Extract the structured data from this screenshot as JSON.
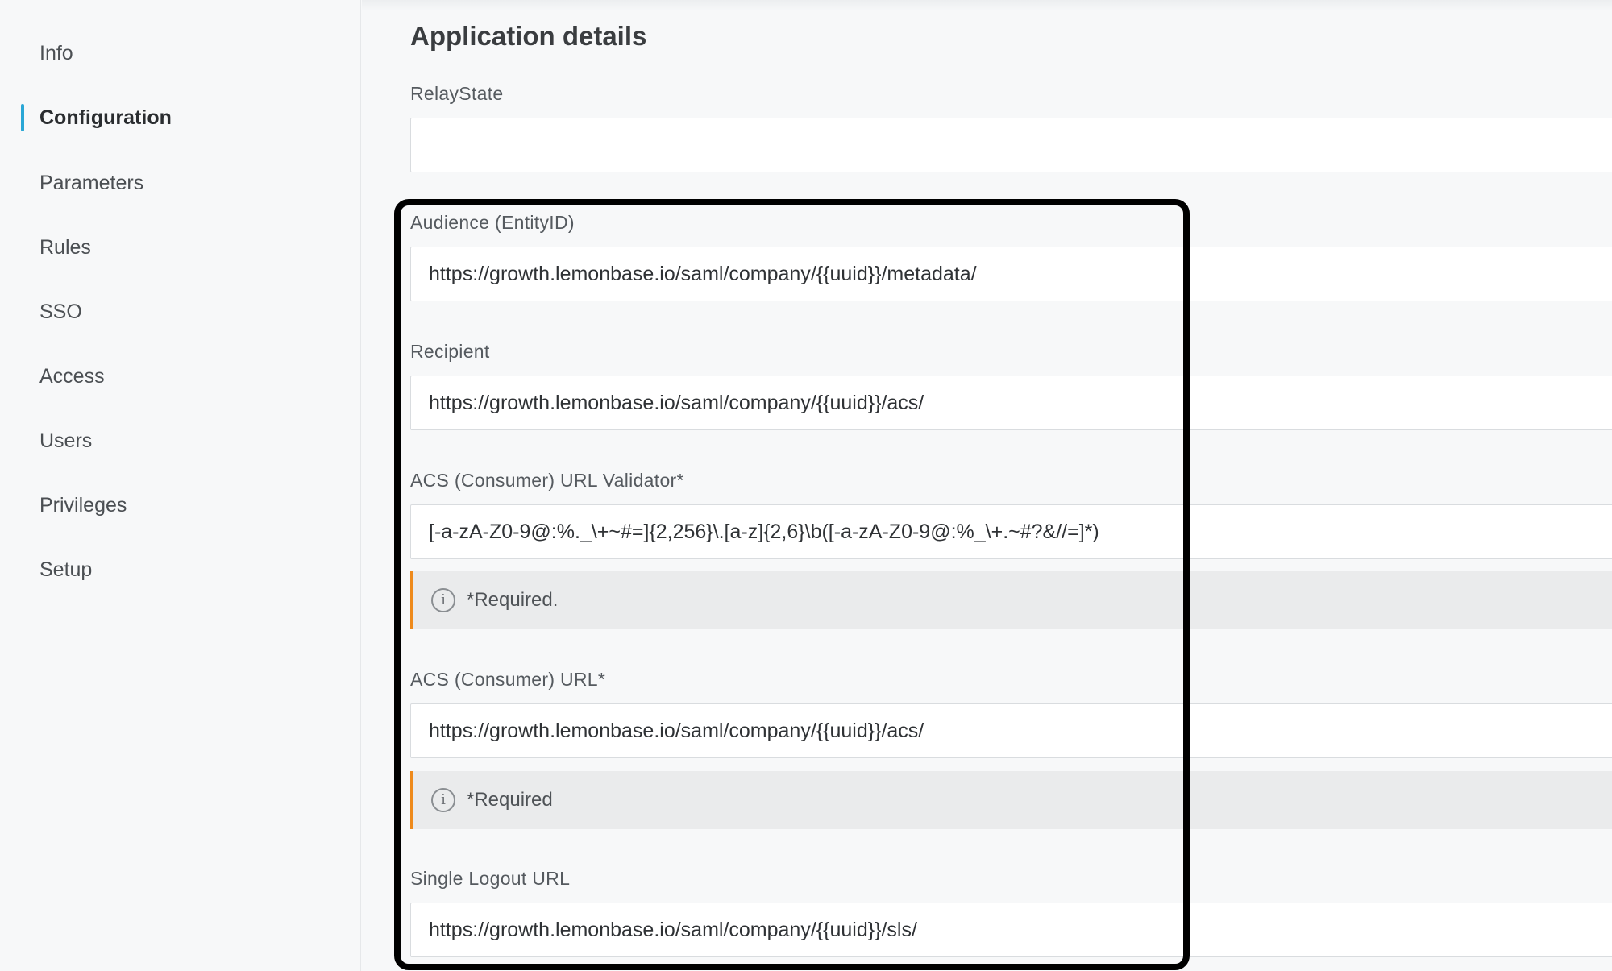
{
  "sidebar": {
    "items": [
      {
        "label": "Info",
        "active": false
      },
      {
        "label": "Configuration",
        "active": true
      },
      {
        "label": "Parameters",
        "active": false
      },
      {
        "label": "Rules",
        "active": false
      },
      {
        "label": "SSO",
        "active": false
      },
      {
        "label": "Access",
        "active": false
      },
      {
        "label": "Users",
        "active": false
      },
      {
        "label": "Privileges",
        "active": false
      },
      {
        "label": "Setup",
        "active": false
      }
    ]
  },
  "main": {
    "title": "Application details",
    "fields": {
      "relay_state": {
        "label": "RelayState",
        "value": ""
      },
      "audience": {
        "label": "Audience (EntityID)",
        "value": "https://growth.lemonbase.io/saml/company/{{uuid}}/metadata/"
      },
      "recipient": {
        "label": "Recipient",
        "value": "https://growth.lemonbase.io/saml/company/{{uuid}}/acs/"
      },
      "acs_validator": {
        "label": "ACS (Consumer) URL Validator*",
        "value": "[-a-zA-Z0-9@:%._\\+~#=]{2,256}\\.[a-z]{2,6}\\b([-a-zA-Z0-9@:%_\\+.~#?&//=]*)",
        "notice": "*Required."
      },
      "acs_url": {
        "label": "ACS (Consumer) URL*",
        "value": "https://growth.lemonbase.io/saml/company/{{uuid}}/acs/",
        "notice": "*Required"
      },
      "single_logout": {
        "label": "Single Logout URL",
        "value": "https://growth.lemonbase.io/saml/company/{{uuid}}/sls/"
      }
    }
  },
  "colors": {
    "accent": "#2aa7d6",
    "notice_bar": "#ee8a1c",
    "highlight_frame": "#000000"
  },
  "icons": {
    "notice_icon": "info-circle-icon"
  }
}
